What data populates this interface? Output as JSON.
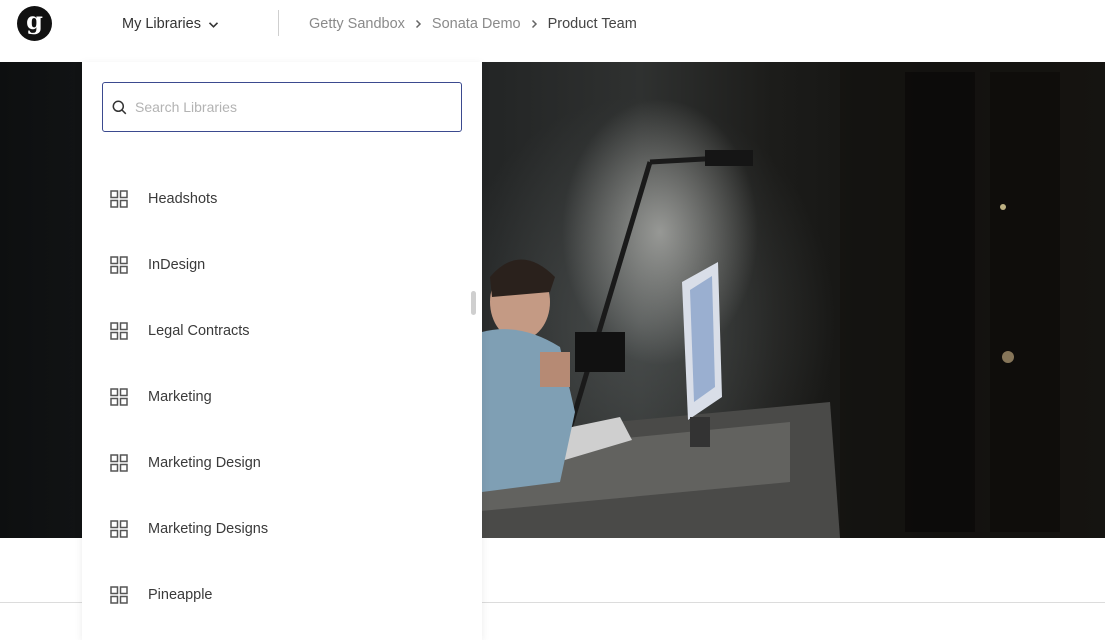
{
  "header": {
    "logo_letter": "g",
    "library_switcher_label": "My Libraries",
    "breadcrumb": [
      "Getty Sandbox",
      "Sonata Demo",
      "Product Team"
    ]
  },
  "dropdown": {
    "search_placeholder": "Search Libraries",
    "libraries": [
      {
        "label": "Headshots",
        "icon": "grid-icon"
      },
      {
        "label": "InDesign",
        "icon": "grid-icon"
      },
      {
        "label": "Legal Contracts",
        "icon": "grid-icon"
      },
      {
        "label": "Marketing",
        "icon": "grid-icon"
      },
      {
        "label": "Marketing Design",
        "icon": "grid-icon"
      },
      {
        "label": "Marketing Designs",
        "icon": "grid-icon"
      },
      {
        "label": "Pineapple",
        "icon": "grid-icon"
      }
    ]
  },
  "colors": {
    "search_border": "#3b4a8f",
    "logo_bg": "#111111"
  }
}
